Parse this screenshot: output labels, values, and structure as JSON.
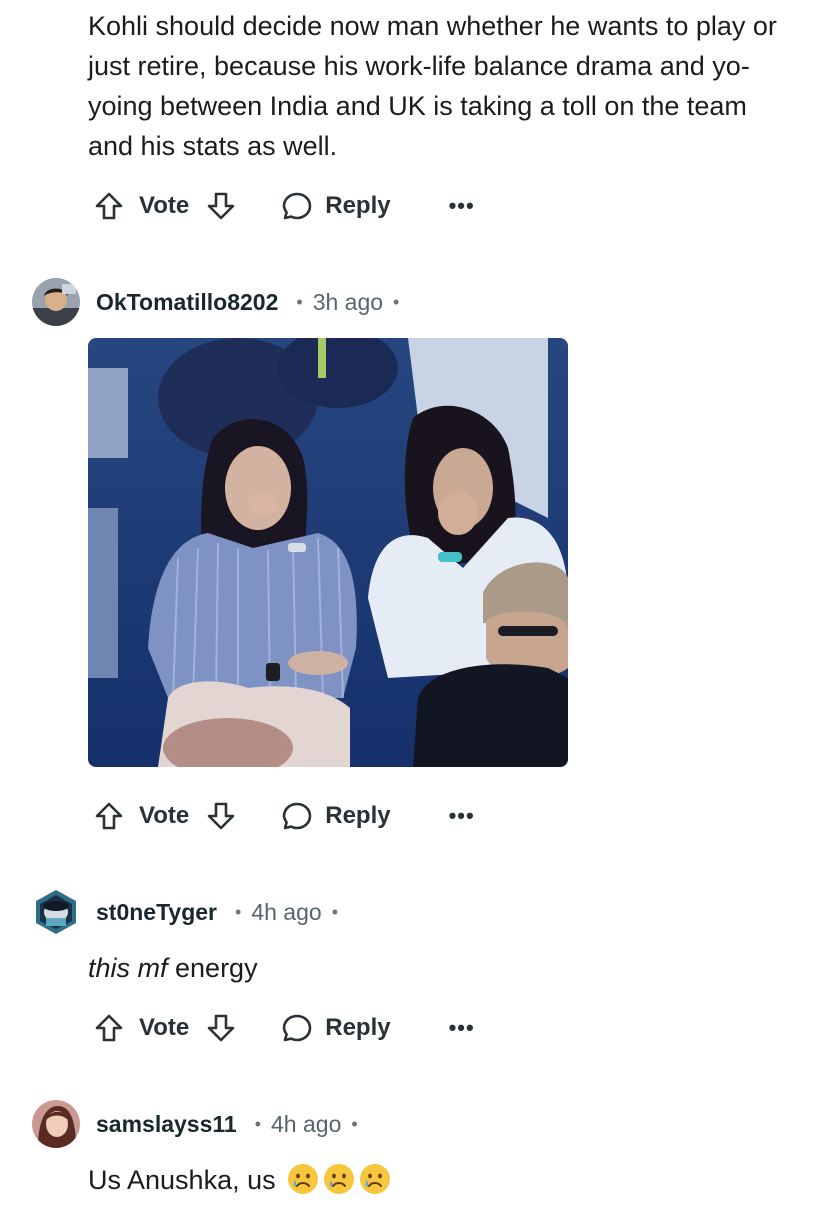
{
  "comments": [
    {
      "body": "Kohli should decide now man whether he wants to play or just retire, because his work-life balance drama and yo-yoing between India and UK is taking a toll on the team and his stats as well.",
      "actions": {
        "vote": "Vote",
        "reply": "Reply",
        "more": "•••"
      }
    },
    {
      "username": "OkTomatillo8202",
      "separator": "•",
      "time": "3h ago",
      "actions": {
        "vote": "Vote",
        "reply": "Reply",
        "more": "•••"
      }
    },
    {
      "username": "st0neTyger",
      "separator": "•",
      "time": "4h ago",
      "body_italic": "this mf",
      "body_rest": " energy",
      "actions": {
        "vote": "Vote",
        "reply": "Reply",
        "more": "•••"
      }
    },
    {
      "username": "samslayss11",
      "separator": "•",
      "time": "4h ago",
      "body": "Us Anushka, us"
    }
  ],
  "icons": {
    "upvote": "arrow-up-icon",
    "downvote": "arrow-down-icon",
    "reply": "speech-bubble-icon",
    "emoji": "sad-tear-face-emoji"
  },
  "colors": {
    "text": "#1c1c1c",
    "meta": "#58656b",
    "action": "#2a3236",
    "image_tint": "#1f3d7a"
  }
}
